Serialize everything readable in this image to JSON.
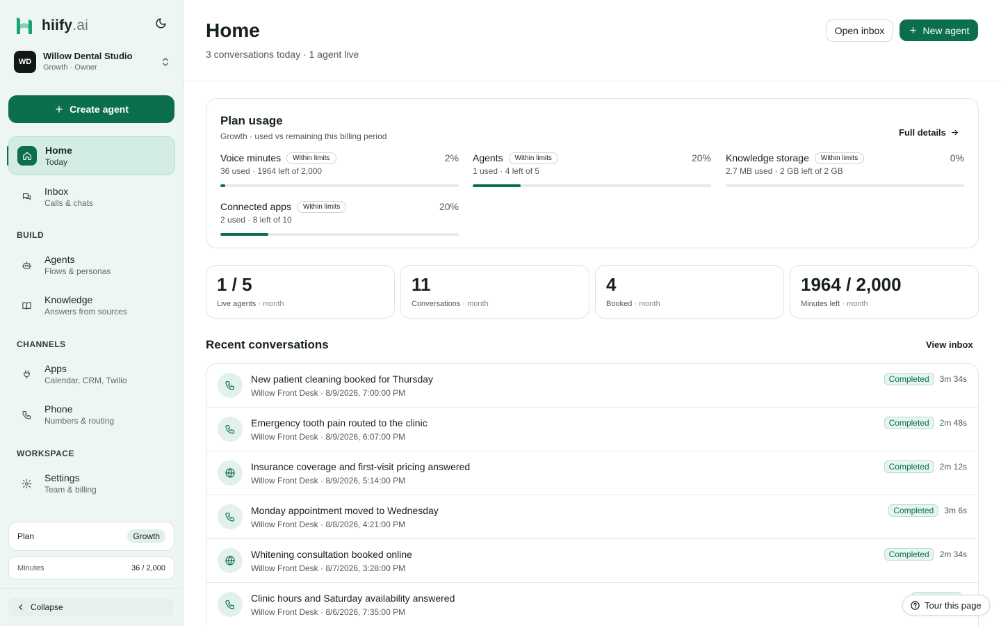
{
  "brand": {
    "name": "hiify",
    "suffix": ".ai",
    "logo_icon": "h-logo-icon",
    "theme_icon": "moon-icon"
  },
  "workspace": {
    "initials": "WD",
    "name": "Willow Dental Studio",
    "subtitle": "Growth · Owner"
  },
  "sidebar": {
    "create_label": "Create agent",
    "nav": [
      {
        "title": "Home",
        "subtitle": "Today",
        "icon": "home-icon",
        "active": true
      },
      {
        "title": "Inbox",
        "subtitle": "Calls & chats",
        "icon": "chat-icon"
      },
      {
        "title": "Agents",
        "subtitle": "Flows & personas",
        "icon": "bot-icon"
      },
      {
        "title": "Knowledge",
        "subtitle": "Answers from sources",
        "icon": "book-icon"
      },
      {
        "title": "Apps",
        "subtitle": "Calendar, CRM, Twilio",
        "icon": "plug-icon"
      },
      {
        "title": "Phone",
        "subtitle": "Numbers & routing",
        "icon": "phone-icon"
      },
      {
        "title": "Settings",
        "subtitle": "Team & billing",
        "icon": "gear-icon"
      }
    ],
    "sections": {
      "build": "BUILD",
      "channels": "CHANNELS",
      "workspace": "WORKSPACE"
    },
    "plan": {
      "label": "Plan",
      "value": "Growth"
    },
    "minutes": {
      "label": "Minutes",
      "value": "36 / 2,000"
    },
    "collapse_label": "Collapse"
  },
  "header": {
    "title": "Home",
    "subtitle": "3 conversations today · 1 agent live",
    "open_inbox": "Open inbox",
    "new_agent": "New agent"
  },
  "usage": {
    "title": "Plan usage",
    "subtitle": "Growth · used vs remaining this billing period",
    "full_details": "Full details",
    "metrics": [
      {
        "name": "Voice minutes",
        "pill": "Within limits",
        "pct_label": "2%",
        "detail": "36 used · 1964 left of 2,000",
        "fraction": 0.02
      },
      {
        "name": "Agents",
        "pill": "Within limits",
        "pct_label": "20%",
        "detail": "1 used · 4 left of 5",
        "fraction": 0.2
      },
      {
        "name": "Knowledge storage",
        "pill": "Within limits",
        "pct_label": "0%",
        "detail": "2.7 MB used · 2 GB left of 2 GB",
        "fraction": 0.0
      },
      {
        "name": "Connected apps",
        "pill": "Within limits",
        "pct_label": "20%",
        "detail": "2 used · 8 left of 10",
        "fraction": 0.2
      }
    ]
  },
  "stats": [
    {
      "value": "1 / 5",
      "label": "Live agents",
      "period": "month"
    },
    {
      "value": "11",
      "label": "Conversations",
      "period": "month"
    },
    {
      "value": "4",
      "label": "Booked",
      "period": "month"
    },
    {
      "value": "1964 / 2,000",
      "label": "Minutes left",
      "period": "month"
    }
  ],
  "recent": {
    "title": "Recent conversations",
    "view_inbox": "View inbox",
    "rows": [
      {
        "title": "New patient cleaning booked for Thursday",
        "meta": "Willow Front Desk · 8/9/2026, 7:00:00 PM",
        "status": "Completed",
        "duration": "3m 34s",
        "icon": "phone-icon"
      },
      {
        "title": "Emergency tooth pain routed to the clinic",
        "meta": "Willow Front Desk · 8/9/2026, 6:07:00 PM",
        "status": "Completed",
        "duration": "2m 48s",
        "icon": "phone-icon"
      },
      {
        "title": "Insurance coverage and first-visit pricing answered",
        "meta": "Willow Front Desk · 8/9/2026, 5:14:00 PM",
        "status": "Completed",
        "duration": "2m 12s",
        "icon": "globe-icon"
      },
      {
        "title": "Monday appointment moved to Wednesday",
        "meta": "Willow Front Desk · 8/8/2026, 4:21:00 PM",
        "status": "Completed",
        "duration": "3m 6s",
        "icon": "phone-icon"
      },
      {
        "title": "Whitening consultation booked online",
        "meta": "Willow Front Desk · 8/7/2026, 3:28:00 PM",
        "status": "Completed",
        "duration": "2m 34s",
        "icon": "globe-icon"
      },
      {
        "title": "Clinic hours and Saturday availability answered",
        "meta": "Willow Front Desk · 8/6/2026, 7:35:00 PM",
        "status": "Completed",
        "duration": "",
        "icon": "phone-icon"
      }
    ]
  },
  "tour_label": "Tour this page",
  "colors": {
    "accent": "#0b6e4f",
    "sidebar_bg": "#eef6f2",
    "active_bg": "#d4ede3"
  }
}
